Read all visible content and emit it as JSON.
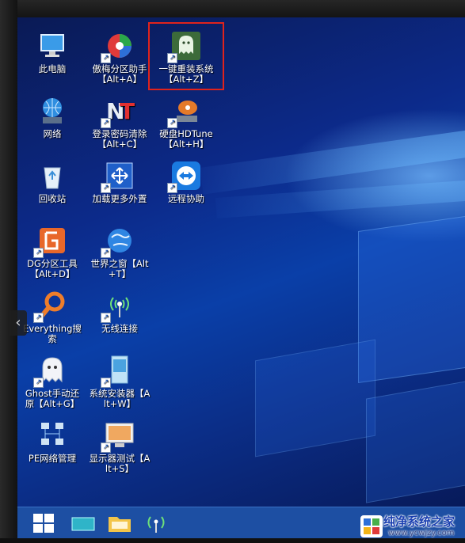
{
  "desktop": {
    "icons": [
      {
        "label": "此电脑",
        "icon": "computer-icon"
      },
      {
        "label": "傲梅分区助手【Alt+A】",
        "icon": "partition-assistant-icon"
      },
      {
        "label": "一键重装系统【Alt+Z】",
        "icon": "ghost-reinstall-icon"
      },
      {
        "label": "网络",
        "icon": "network-globe-icon"
      },
      {
        "label": "登录密码清除【Alt+C】",
        "icon": "password-clear-icon"
      },
      {
        "label": "硬盘HDTune【Alt+H】",
        "icon": "hdtune-icon"
      },
      {
        "label": "回收站",
        "icon": "recycle-bin-icon"
      },
      {
        "label": "加载更多外置",
        "icon": "load-more-icon"
      },
      {
        "label": "远程协助",
        "icon": "teamviewer-icon"
      },
      {
        "label": "DG分区工具【Alt+D】",
        "icon": "diskgenius-icon"
      },
      {
        "label": "世界之窗【Alt+T】",
        "icon": "browser-globe-icon"
      },
      {
        "label": "Everything搜索",
        "icon": "everything-search-icon"
      },
      {
        "label": "无线连接",
        "icon": "wireless-icon"
      },
      {
        "label": "Ghost手动还原【Alt+G】",
        "icon": "ghost-icon"
      },
      {
        "label": "系统安装器【Alt+W】",
        "icon": "system-installer-icon"
      },
      {
        "label": "PE网络管理",
        "icon": "pe-network-icon"
      },
      {
        "label": "显示器测试【Alt+S】",
        "icon": "monitor-test-icon"
      }
    ]
  },
  "taskbar": {
    "items": [
      "start-icon",
      "taskview-icon",
      "file-explorer-icon",
      "tray-wireless-icon"
    ]
  },
  "watermark": {
    "title": "纯净系统之家",
    "url": "www.ycwjzy.com"
  },
  "colors": {
    "selection": "#e0231c",
    "taskbar": "#1d4fa3"
  }
}
